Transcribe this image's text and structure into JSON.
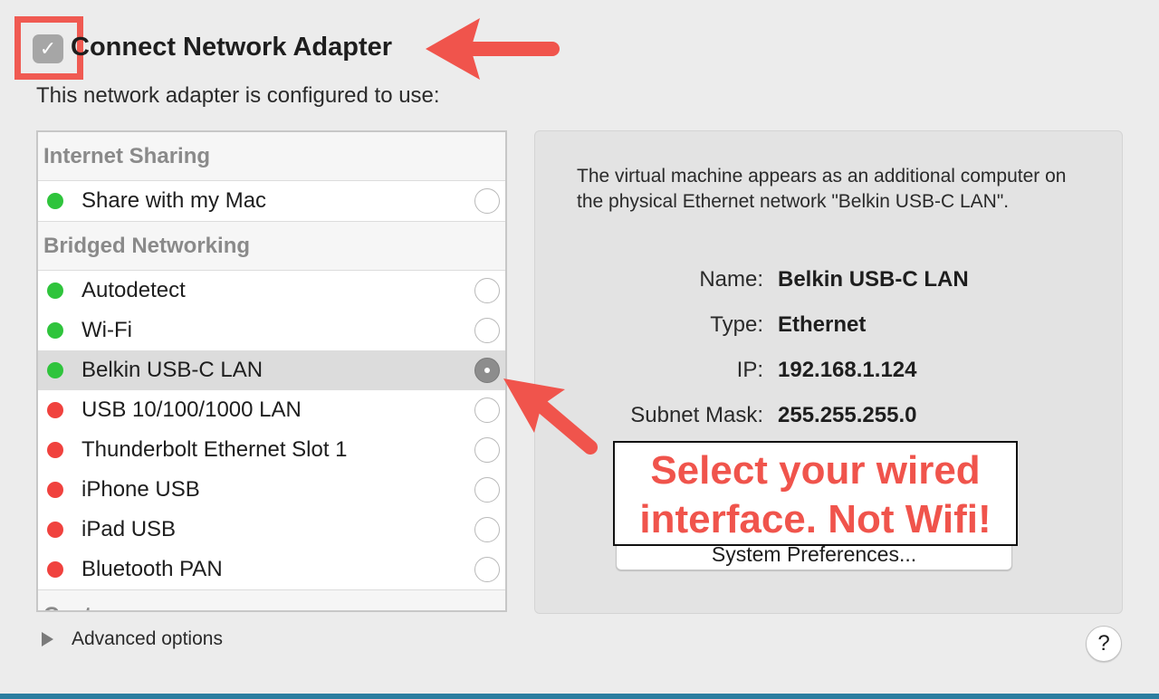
{
  "header": {
    "title": "Connect Network Adapter",
    "checkbox_glyph": "✓",
    "subtitle": "This network adapter is configured to use:"
  },
  "list": {
    "internet_sharing": {
      "header": "Internet Sharing",
      "items": [
        {
          "label": "Share with my Mac",
          "status": "green"
        }
      ]
    },
    "bridged": {
      "header": "Bridged Networking",
      "items": [
        {
          "label": "Autodetect",
          "status": "green"
        },
        {
          "label": "Wi-Fi",
          "status": "green"
        },
        {
          "label": "Belkin USB-C LAN",
          "status": "green",
          "selected": true
        },
        {
          "label": "USB 10/100/1000 LAN",
          "status": "red"
        },
        {
          "label": "Thunderbolt Ethernet Slot 1",
          "status": "red"
        },
        {
          "label": "iPhone USB",
          "status": "red"
        },
        {
          "label": "iPad USB",
          "status": "red"
        },
        {
          "label": "Bluetooth PAN",
          "status": "red"
        }
      ]
    },
    "custom_header": "Custom"
  },
  "panel": {
    "description": "The virtual machine appears as an additional computer on the physical Ethernet network \"Belkin USB-C LAN\".",
    "fields": [
      {
        "key": "Name:",
        "value": "Belkin USB-C LAN"
      },
      {
        "key": "Type:",
        "value": "Ethernet"
      },
      {
        "key": "IP:",
        "value": "192.168.1.124"
      },
      {
        "key": "Subnet Mask:",
        "value": "255.255.255.0"
      }
    ],
    "system_prefs_button": "System Preferences..."
  },
  "annotation": {
    "line1": "Select your wired",
    "line2": "interface. Not Wifi!"
  },
  "footer": {
    "advanced_label": "Advanced options",
    "help_label": "?"
  },
  "colors": {
    "status_green": "#2fc43c",
    "status_red": "#f0423e",
    "annotation_red": "#f0544c",
    "selected_row": "#dcdcdc"
  }
}
